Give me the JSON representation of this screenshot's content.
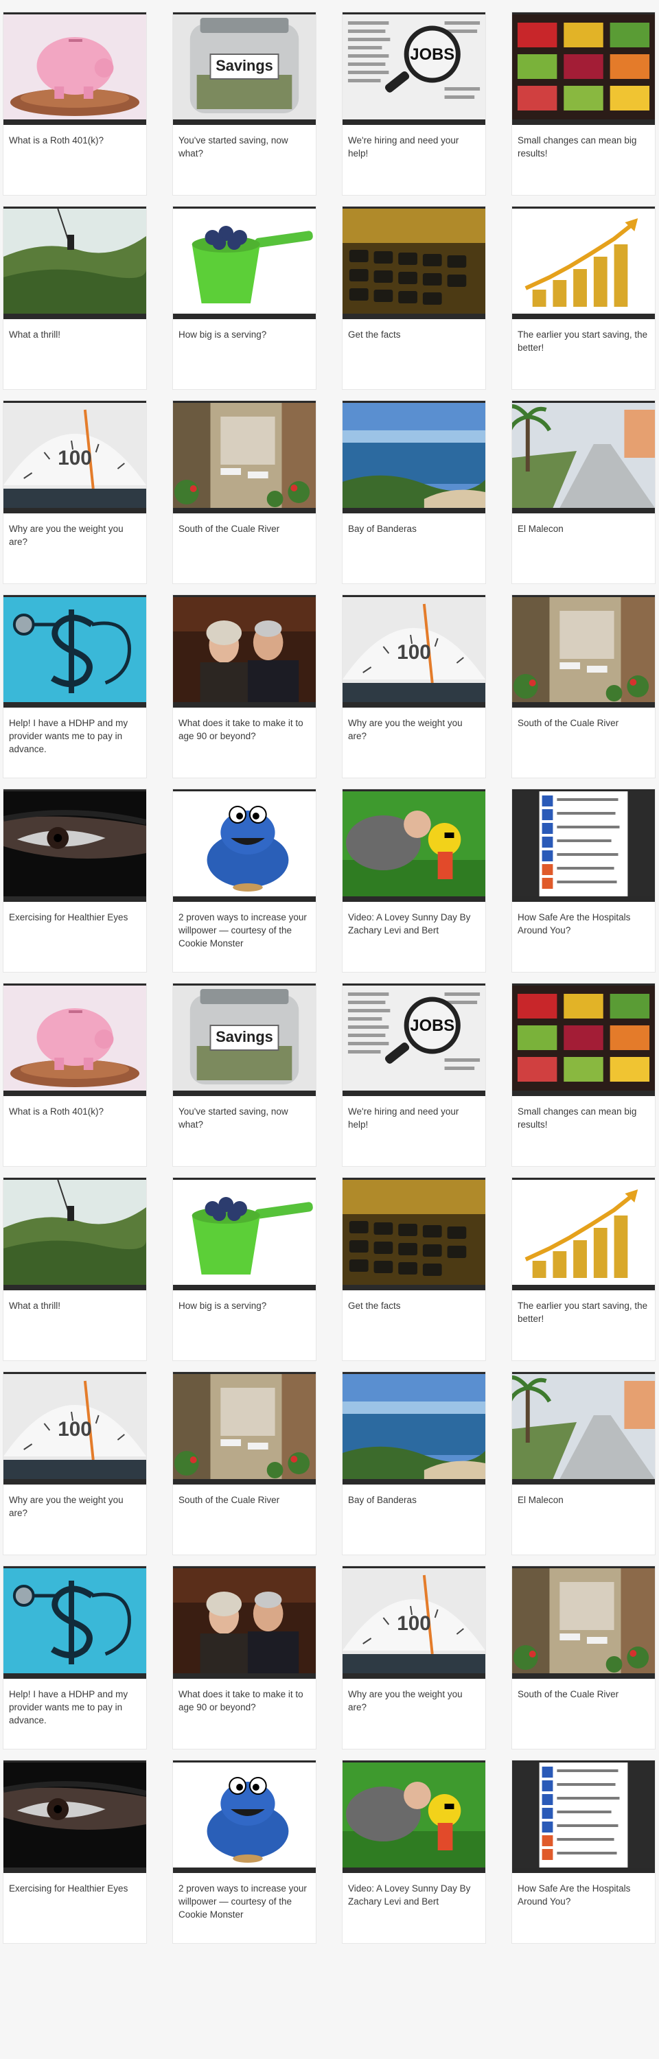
{
  "cards": [
    {
      "title": "What is a Roth 401(k)?",
      "image": "piggy-bank",
      "thumb_label": ""
    },
    {
      "title": "You've started saving, now what?",
      "image": "savings-jar",
      "thumb_label": "Savings"
    },
    {
      "title": "We're hiring and need your help!",
      "image": "newspaper-jobs",
      "thumb_label": "JOBS"
    },
    {
      "title": "Small changes can mean big results!",
      "image": "produce",
      "thumb_label": ""
    },
    {
      "title": "What a thrill!",
      "image": "zipline",
      "thumb_label": ""
    },
    {
      "title": "How big is a serving?",
      "image": "blueberry-cup",
      "thumb_label": ""
    },
    {
      "title": "Get the facts",
      "image": "calculator",
      "thumb_label": ""
    },
    {
      "title": "The earlier you start saving, the better!",
      "image": "coin-growth",
      "thumb_label": ""
    },
    {
      "title": "Why are you the weight you are?",
      "image": "scale",
      "thumb_label": "100"
    },
    {
      "title": "South of the Cuale River",
      "image": "street-cafe",
      "thumb_label": ""
    },
    {
      "title": "Bay of Banderas",
      "image": "bay",
      "thumb_label": ""
    },
    {
      "title": "El Malecon",
      "image": "malecon",
      "thumb_label": ""
    },
    {
      "title": "Help! I have a HDHP and my provider wants me to pay in advance.",
      "image": "dollar-stethoscope",
      "thumb_label": ""
    },
    {
      "title": "What does it take to make it to age 90 or beyond?",
      "image": "elderly-couple",
      "thumb_label": ""
    },
    {
      "title": "Why are you the weight you are?",
      "image": "scale",
      "thumb_label": "100"
    },
    {
      "title": "South of the Cuale River",
      "image": "street-cafe",
      "thumb_label": ""
    },
    {
      "title": "Exercising for Healthier Eyes",
      "image": "eye",
      "thumb_label": ""
    },
    {
      "title": "2 proven ways to increase your willpower — courtesy of the Cookie Monster",
      "image": "cookie-monster",
      "thumb_label": ""
    },
    {
      "title": "Video: A Lovey Sunny Day By Zachary Levi and Bert",
      "image": "lying-grass",
      "thumb_label": ""
    },
    {
      "title": "How Safe Are the Hospitals Around You?",
      "image": "hospital-list",
      "thumb_label": ""
    },
    {
      "title": "What is a Roth 401(k)?",
      "image": "piggy-bank",
      "thumb_label": ""
    },
    {
      "title": "You've started saving, now what?",
      "image": "savings-jar",
      "thumb_label": "Savings"
    },
    {
      "title": "We're hiring and need your help!",
      "image": "newspaper-jobs",
      "thumb_label": "JOBS"
    },
    {
      "title": "Small changes can mean big results!",
      "image": "produce",
      "thumb_label": ""
    },
    {
      "title": "What a thrill!",
      "image": "zipline",
      "thumb_label": ""
    },
    {
      "title": "How big is a serving?",
      "image": "blueberry-cup",
      "thumb_label": ""
    },
    {
      "title": "Get the facts",
      "image": "calculator",
      "thumb_label": ""
    },
    {
      "title": "The earlier you start saving, the better!",
      "image": "coin-growth",
      "thumb_label": ""
    },
    {
      "title": "Why are you the weight you are?",
      "image": "scale",
      "thumb_label": "100"
    },
    {
      "title": "South of the Cuale River",
      "image": "street-cafe",
      "thumb_label": ""
    },
    {
      "title": "Bay of Banderas",
      "image": "bay",
      "thumb_label": ""
    },
    {
      "title": "El Malecon",
      "image": "malecon",
      "thumb_label": ""
    },
    {
      "title": "Help! I have a HDHP and my provider wants me to pay in advance.",
      "image": "dollar-stethoscope",
      "thumb_label": ""
    },
    {
      "title": "What does it take to make it to age 90 or beyond?",
      "image": "elderly-couple",
      "thumb_label": ""
    },
    {
      "title": "Why are you the weight you are?",
      "image": "scale",
      "thumb_label": "100"
    },
    {
      "title": "South of the Cuale River",
      "image": "street-cafe",
      "thumb_label": ""
    },
    {
      "title": "Exercising for Healthier Eyes",
      "image": "eye",
      "thumb_label": ""
    },
    {
      "title": "2 proven ways to increase your willpower — courtesy of the Cookie Monster",
      "image": "cookie-monster",
      "thumb_label": ""
    },
    {
      "title": "Video: A Lovey Sunny Day By Zachary Levi and Bert",
      "image": "lying-grass",
      "thumb_label": ""
    },
    {
      "title": "How Safe Are the Hospitals Around You?",
      "image": "hospital-list",
      "thumb_label": ""
    }
  ]
}
